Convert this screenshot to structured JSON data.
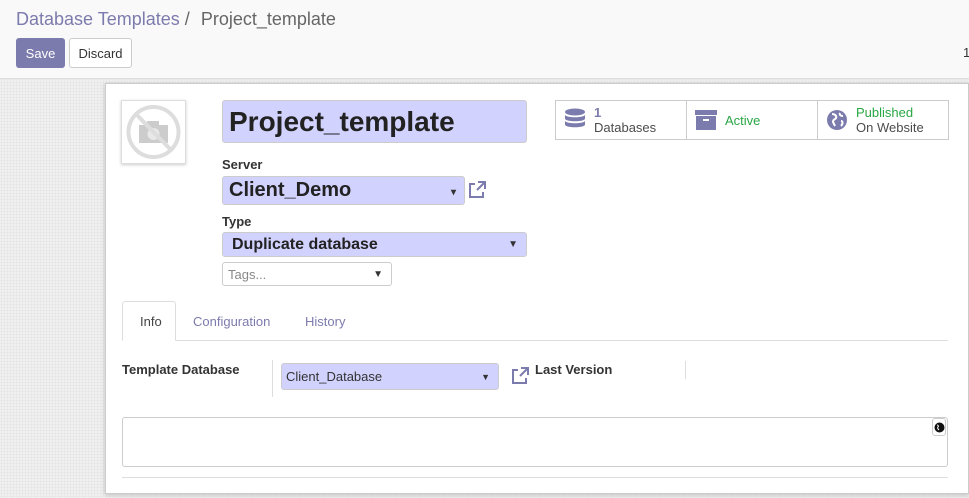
{
  "breadcrumb": {
    "parent": "Database Templates",
    "separator": "/",
    "current": "Project_template"
  },
  "toolbar": {
    "save_label": "Save",
    "discard_label": "Discard",
    "pager": "1"
  },
  "form": {
    "image_icon": "no-image-camera-icon",
    "name": "Project_template",
    "server_label": "Server",
    "server_value": "Client_Demo",
    "type_label": "Type",
    "type_value": "Duplicate database",
    "tags_placeholder": "Tags..."
  },
  "smart_buttons": [
    {
      "icon": "database-icon",
      "value": "1",
      "label": "Databases"
    },
    {
      "icon": "archive-icon",
      "label": "Active"
    },
    {
      "icon": "globe-icon",
      "line1": "Published",
      "line2": "On Website"
    }
  ],
  "tabs": [
    {
      "label": "Info",
      "active": true
    },
    {
      "label": "Configuration"
    },
    {
      "label": "History"
    }
  ],
  "info": {
    "template_db_label": "Template Database",
    "template_db_value": "Client_Database",
    "last_version_label": "Last Version"
  },
  "colors": {
    "accent": "#7c7bad",
    "required_bg": "#d2d2ff",
    "published": "#28a745"
  }
}
